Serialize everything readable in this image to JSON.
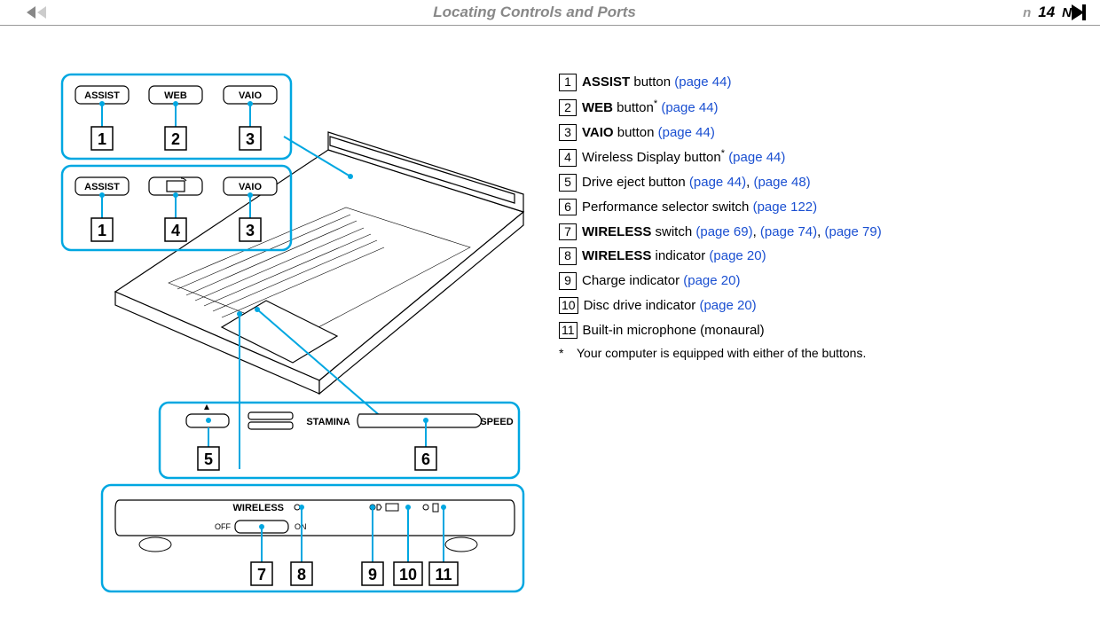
{
  "header": {
    "title": "Locating Controls and Ports",
    "page_number": "14"
  },
  "diagram": {
    "panel_top": {
      "buttons": [
        "ASSIST",
        "WEB",
        "VAIO"
      ],
      "callouts": [
        "1",
        "2",
        "3"
      ]
    },
    "panel_mid": {
      "buttons": [
        "ASSIST",
        "",
        "VAIO"
      ],
      "callouts": [
        "1",
        "4",
        "3"
      ]
    },
    "panel_perf": {
      "labels": [
        "STAMINA",
        "SPEED"
      ],
      "callouts": [
        "5",
        "6"
      ]
    },
    "panel_front": {
      "wireless_label": "WIRELESS",
      "off": "OFF",
      "on": "ON",
      "callouts": [
        "7",
        "8",
        "9",
        "10",
        "11"
      ]
    }
  },
  "legend": [
    {
      "num": "1",
      "bold": "ASSIST",
      "text": " button ",
      "links": [
        "(page 44)"
      ]
    },
    {
      "num": "2",
      "bold": "WEB",
      "text": " button",
      "sup": "*",
      "after": " ",
      "links": [
        "(page 44)"
      ]
    },
    {
      "num": "3",
      "bold": "VAIO",
      "text": " button ",
      "links": [
        "(page 44)"
      ]
    },
    {
      "num": "4",
      "plain": "Wireless Display button",
      "sup": "*",
      "after": " ",
      "links": [
        "(page 44)"
      ]
    },
    {
      "num": "5",
      "plain": "Drive eject button ",
      "links": [
        "(page 44)",
        "(page 48)"
      ]
    },
    {
      "num": "6",
      "plain": "Performance selector switch ",
      "links": [
        "(page 122)"
      ]
    },
    {
      "num": "7",
      "bold": "WIRELESS",
      "text": " switch ",
      "links": [
        "(page 69)",
        "(page 74)",
        "(page 79)"
      ]
    },
    {
      "num": "8",
      "bold": "WIRELESS",
      "text": " indicator ",
      "links": [
        "(page 20)"
      ]
    },
    {
      "num": "9",
      "plain": "Charge indicator ",
      "links": [
        "(page 20)"
      ]
    },
    {
      "num": "10",
      "plain": "Disc drive indicator ",
      "links": [
        "(page 20)"
      ]
    },
    {
      "num": "11",
      "plain": "Built-in microphone (monaural)",
      "links": []
    }
  ],
  "footnote": "Your computer is equipped with either of the buttons."
}
